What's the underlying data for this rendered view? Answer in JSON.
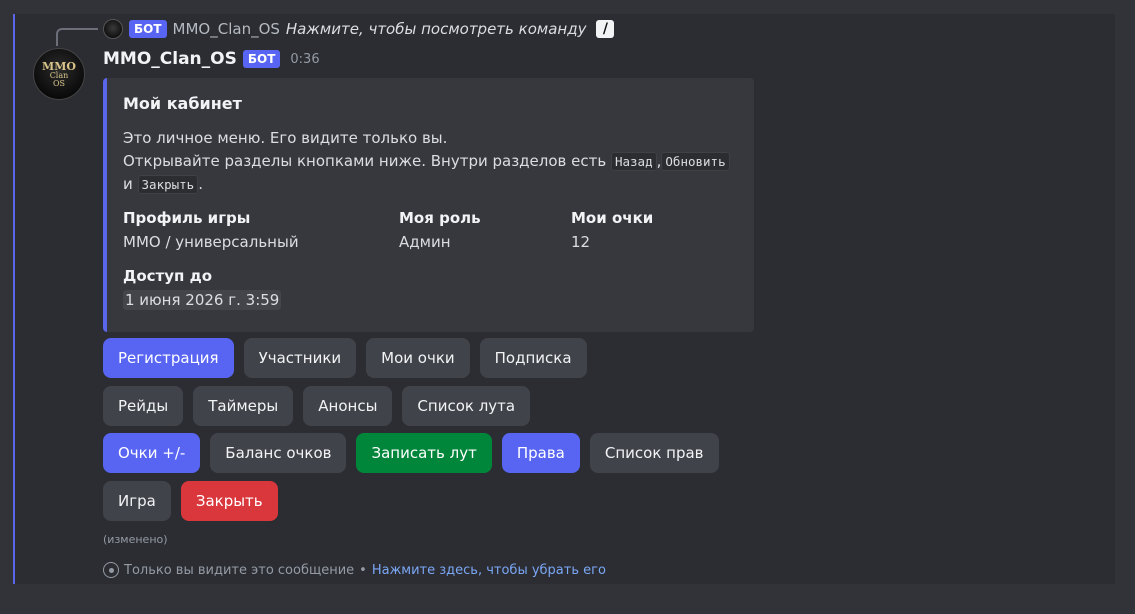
{
  "reply": {
    "bot_tag": "БОТ",
    "author": "MMO_Clan_OS",
    "text": "Нажмите, чтобы посмотреть команду"
  },
  "message": {
    "author": "MMO_Clan_OS",
    "bot_tag": "БОТ",
    "timestamp": "0:36",
    "avatar_text_1": "MMO",
    "avatar_text_2": "Clan",
    "avatar_text_3": "OS"
  },
  "embed": {
    "title": "Мой кабинет",
    "desc_line1": "Это личное меню. Его видите только вы.",
    "desc_line2_prefix": "Открывайте разделы кнопками ниже. Внутри разделов есть ",
    "code_back": "Назад",
    "comma": ",",
    "code_refresh": "Обновить",
    "and_word": "и",
    "code_close": "Закрыть",
    "period": ".",
    "fields": [
      {
        "name": "Профиль игры",
        "value": "MMO / универсальный"
      },
      {
        "name": "Моя роль",
        "value": "Админ"
      },
      {
        "name": "Мои очки",
        "value": "12"
      },
      {
        "name": "Доступ до",
        "value": "1 июня 2026 г. 3:59"
      }
    ]
  },
  "buttons": {
    "row1": [
      {
        "label": "Регистрация",
        "style": "blue"
      },
      {
        "label": "Участники",
        "style": "grey"
      },
      {
        "label": "Мои очки",
        "style": "grey"
      },
      {
        "label": "Подписка",
        "style": "grey"
      }
    ],
    "row2": [
      {
        "label": "Рейды",
        "style": "grey"
      },
      {
        "label": "Таймеры",
        "style": "grey"
      },
      {
        "label": "Анонсы",
        "style": "grey"
      },
      {
        "label": "Список лута",
        "style": "grey"
      }
    ],
    "row3": [
      {
        "label": "Очки +/-",
        "style": "blue"
      },
      {
        "label": "Баланс очков",
        "style": "grey"
      },
      {
        "label": "Записать лут",
        "style": "green"
      },
      {
        "label": "Права",
        "style": "blue"
      },
      {
        "label": "Список прав",
        "style": "grey"
      }
    ],
    "row4": [
      {
        "label": "Игра",
        "style": "grey"
      },
      {
        "label": "Закрыть",
        "style": "red"
      }
    ]
  },
  "edited_label": "(изменено)",
  "ephemeral": {
    "text": "Только вы видите это сообщение",
    "separator": "•",
    "link": "Нажмите здесь, чтобы убрать его"
  },
  "colors": {
    "blurple": "#5865f2",
    "success": "#00863a",
    "danger": "#da373c",
    "secondary": "#41434a",
    "link": "#7aa7f5"
  }
}
